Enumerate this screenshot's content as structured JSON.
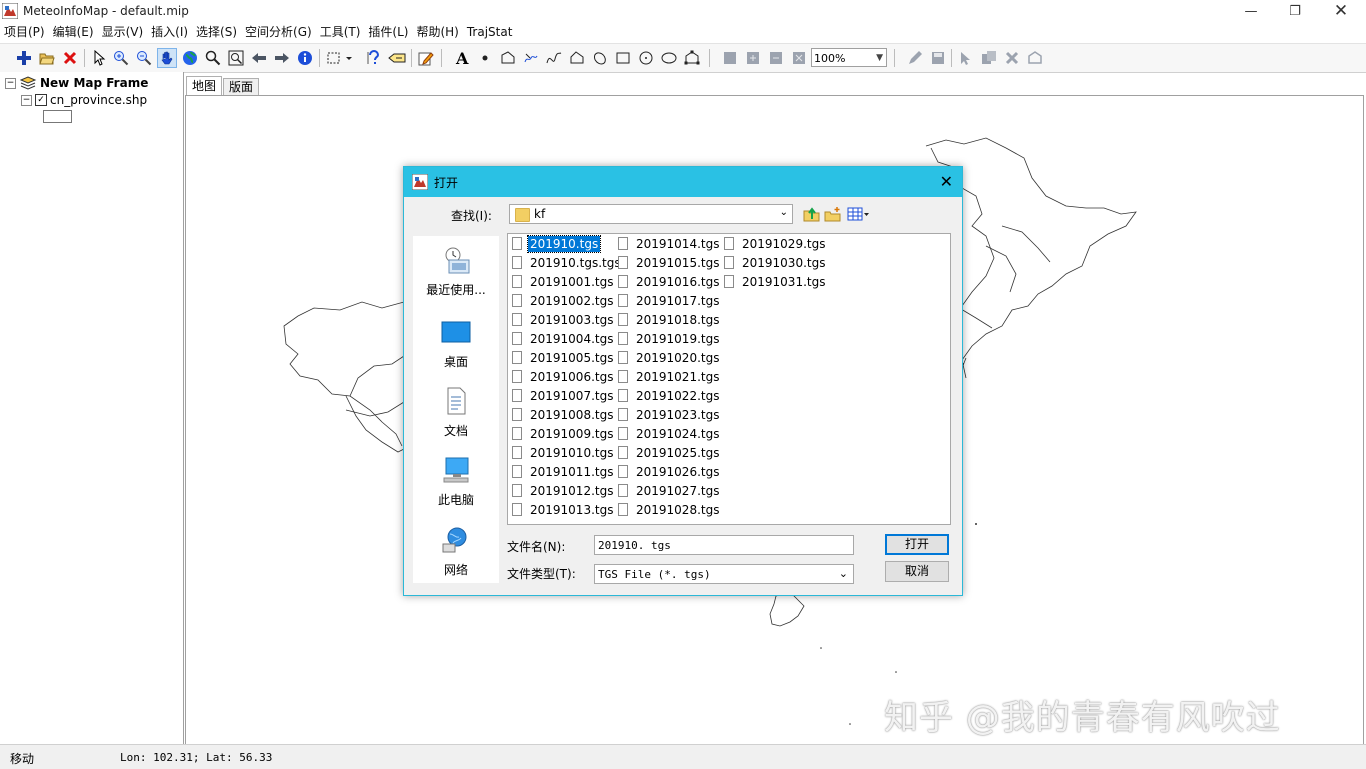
{
  "window": {
    "title": "MeteoInfoMap - default.mip"
  },
  "menu": [
    {
      "label": "项目(P)"
    },
    {
      "label": "编辑(E)"
    },
    {
      "label": "显示(V)"
    },
    {
      "label": "插入(I)"
    },
    {
      "label": "选择(S)"
    },
    {
      "label": "空间分析(G)"
    },
    {
      "label": "工具(T)"
    },
    {
      "label": "插件(L)"
    },
    {
      "label": "帮助(H)"
    },
    {
      "label": "TrajStat"
    }
  ],
  "toolbar": {
    "zoom_value": "100%"
  },
  "layers": {
    "frame_name": "New Map Frame",
    "layer_name": "cn_province.shp",
    "layer_checked": true
  },
  "tabs": [
    {
      "label": "地图",
      "active": true
    },
    {
      "label": "版面",
      "active": false
    }
  ],
  "status": {
    "mode": "移动",
    "coords": "Lon: 102.31; Lat: 56.33"
  },
  "watermark": "知乎 @我的青春有风吹过",
  "dialog": {
    "title": "打开",
    "lookin_label": "查找(I):",
    "lookin_value": "kf",
    "places": [
      {
        "label": "最近使用..."
      },
      {
        "label": "桌面"
      },
      {
        "label": "文档"
      },
      {
        "label": "此电脑"
      },
      {
        "label": "网络"
      }
    ],
    "files_col1": [
      "201910.tgs",
      "201910.tgs.tgs",
      "20191001.tgs",
      "20191002.tgs",
      "20191003.tgs",
      "20191004.tgs",
      "20191005.tgs",
      "20191006.tgs",
      "20191007.tgs",
      "20191008.tgs",
      "20191009.tgs",
      "20191010.tgs",
      "20191011.tgs",
      "20191012.tgs",
      "20191013.tgs"
    ],
    "files_col2": [
      "20191014.tgs",
      "20191015.tgs",
      "20191016.tgs",
      "20191017.tgs",
      "20191018.tgs",
      "20191019.tgs",
      "20191020.tgs",
      "20191021.tgs",
      "20191022.tgs",
      "20191023.tgs",
      "20191024.tgs",
      "20191025.tgs",
      "20191026.tgs",
      "20191027.tgs",
      "20191028.tgs"
    ],
    "files_col3": [
      "20191029.tgs",
      "20191030.tgs",
      "20191031.tgs"
    ],
    "selected_file": "201910.tgs",
    "filename_label": "文件名(N):",
    "filename_value": "201910. tgs",
    "filetype_label": "文件类型(T):",
    "filetype_value": "TGS File (*. tgs)",
    "open_label": "打开",
    "cancel_label": "取消"
  }
}
